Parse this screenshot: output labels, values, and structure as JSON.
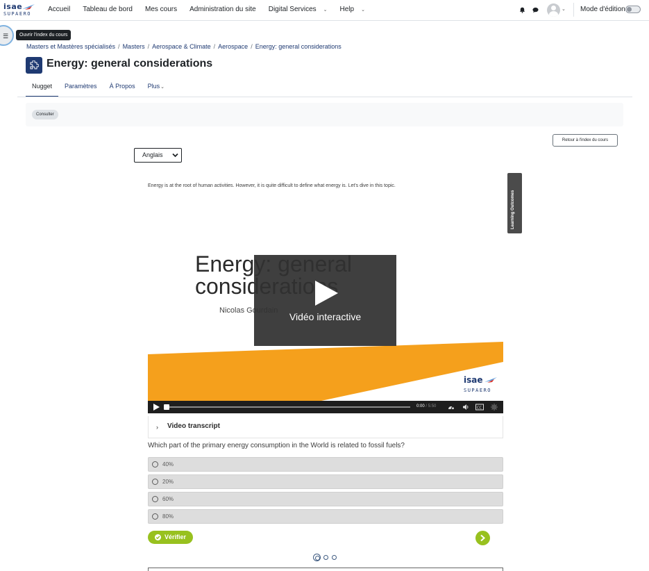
{
  "navbar": {
    "logo_top": "isae",
    "logo_bottom": "SUPAERO",
    "links": [
      {
        "label": "Accueil",
        "dropdown": false
      },
      {
        "label": "Tableau de bord",
        "dropdown": false
      },
      {
        "label": "Mes cours",
        "dropdown": false
      },
      {
        "label": "Administration du site",
        "dropdown": false
      },
      {
        "label": "Digital Services",
        "dropdown": true
      },
      {
        "label": "Help",
        "dropdown": true
      }
    ],
    "edit_mode_label": "Mode d'édition",
    "edit_mode_on": false
  },
  "drawer": {
    "tooltip": "Ouvrir l'index du cours"
  },
  "breadcrumb": [
    "Masters et Mastères spécialisés",
    "Masters",
    "Aerospace & Climate",
    "Aerospace",
    "Energy: general considerations"
  ],
  "page": {
    "title": "Energy: general considerations"
  },
  "tabs": [
    {
      "label": "Nugget",
      "active": true
    },
    {
      "label": "Paramètres",
      "active": false
    },
    {
      "label": "À Propos",
      "active": false
    },
    {
      "label": "Plus",
      "active": false
    }
  ],
  "activity": {
    "consult_label": "Consulter",
    "back_label": "Retour à l'index du cours"
  },
  "language_select": {
    "selected": "Anglais"
  },
  "learning_outcomes_label": "Learning Outcomes",
  "content": {
    "intro": "Energy is at the root of human activities. However, it is quite difficult to define what energy is. Let's dive in this topic.",
    "video": {
      "slide_title_line1": "Energy: general",
      "slide_title_line2": "considerations",
      "author": "Nicolas Gourdain",
      "overlay_label": "Vidéo interactive",
      "time_current": "0:00",
      "time_total": "/ 5:50",
      "logo_top": "isae",
      "logo_bottom": "SUPAERO"
    },
    "transcript_label": "Video transcript",
    "question": "Which part of the primary energy consumption in the World is related to fossil fuels?",
    "answers": [
      "40%",
      "20%",
      "60%",
      "80%"
    ],
    "check_label": "Vérifier",
    "pager": {
      "count": 3,
      "current": 1
    }
  },
  "colors": {
    "brand_navy": "#1f3a72",
    "accent_green": "#98c11f",
    "slide_orange": "#f5a01c"
  }
}
